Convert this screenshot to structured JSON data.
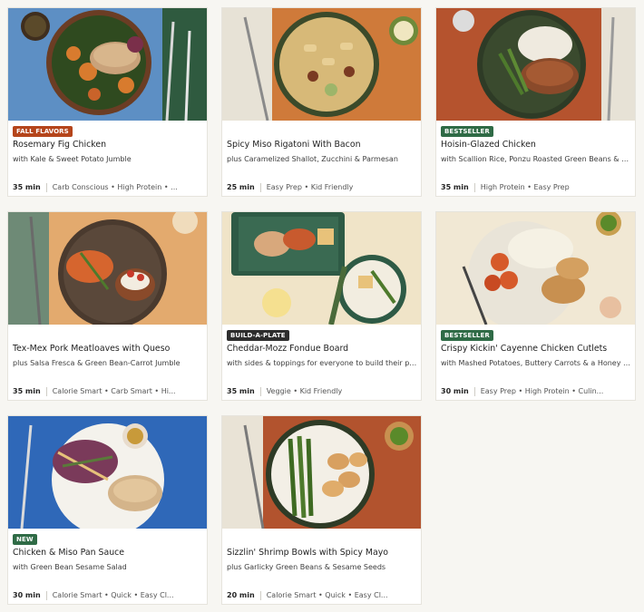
{
  "colors": {
    "badge_fall_flavors": "#b5451b",
    "badge_bestseller": "#2f6b46",
    "badge_build_a_plate": "#2d2d2d",
    "badge_new": "#2f6b46"
  },
  "cards": [
    {
      "badge": "FALL FLAVORS",
      "title": "Rosemary Fig Chicken",
      "subtitle": "with Kale & Sweet Potato Jumble",
      "time": "35 min",
      "tags": "Carb Conscious • High Protein • ..."
    },
    {
      "badge": "",
      "title": "Spicy Miso Rigatoni With Bacon",
      "subtitle": "plus Caramelized Shallot, Zucchini & Parmesan",
      "time": "25 min",
      "tags": "Easy Prep • Kid Friendly"
    },
    {
      "badge": "BESTSELLER",
      "title": "Hoisin-Glazed Chicken",
      "subtitle": "with Scallion Rice, Ponzu Roasted Green Beans & Sr...",
      "time": "35 min",
      "tags": "High Protein • Easy Prep"
    },
    {
      "badge": "",
      "title": "Tex-Mex Pork Meatloaves with Queso",
      "subtitle": "plus Salsa Fresca & Green Bean-Carrot Jumble",
      "time": "35 min",
      "tags": "Calorie Smart • Carb Smart • Hi..."
    },
    {
      "badge": "BUILD-A-PLATE",
      "title": "Cheddar-Mozz Fondue Board",
      "subtitle": "with sides & toppings for everyone to build their pe...",
      "time": "35 min",
      "tags": "Veggie • Kid Friendly"
    },
    {
      "badge": "BESTSELLER",
      "title": "Crispy Kickin' Cayenne Chicken Cutlets",
      "subtitle": "with Mashed Potatoes, Buttery Carrots & a Honey D...",
      "time": "30 min",
      "tags": "Easy Prep • High Protein • Culin..."
    },
    {
      "badge": "NEW",
      "title": "Chicken & Miso Pan Sauce",
      "subtitle": "with Green Bean Sesame Salad",
      "time": "30 min",
      "tags": "Calorie Smart • Quick • Easy Cl..."
    },
    {
      "badge": "",
      "title": "Sizzlin' Shrimp Bowls with Spicy Mayo",
      "subtitle": "plus Garlicky Green Beans & Sesame Seeds",
      "time": "20 min",
      "tags": "Calorie Smart • Quick • Easy Cl..."
    }
  ]
}
